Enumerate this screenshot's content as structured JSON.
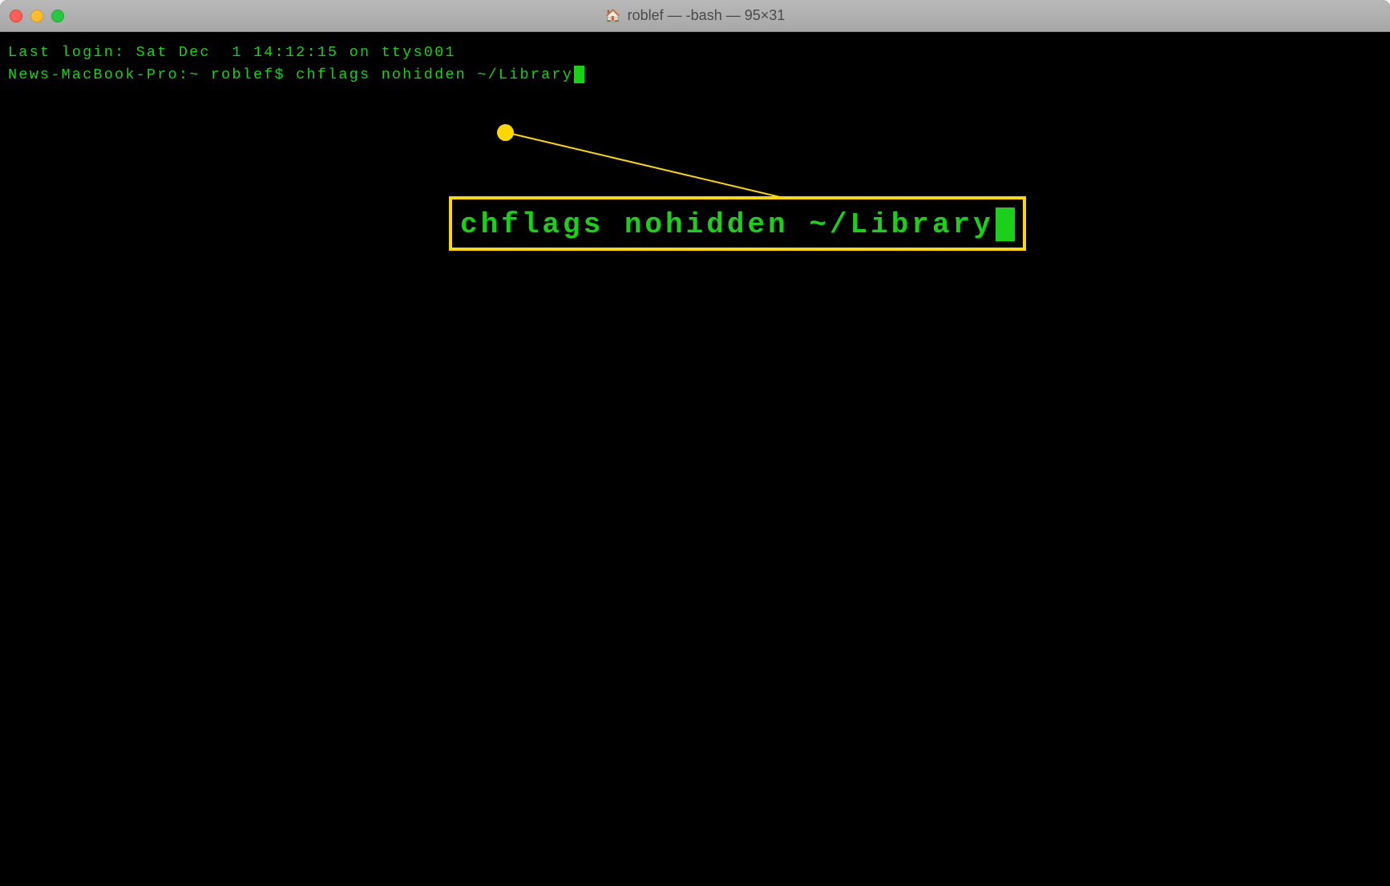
{
  "window": {
    "title": "roblef — -bash — 95×31",
    "home_icon": "🏠"
  },
  "terminal": {
    "last_login": "Last login: Sat Dec  1 14:12:15 on ttys001",
    "prompt": "News-MacBook-Pro:~ roblef$ ",
    "command": "chflags nohidden ~/Library"
  },
  "callout": {
    "text": "chflags nohidden ~/Library"
  }
}
